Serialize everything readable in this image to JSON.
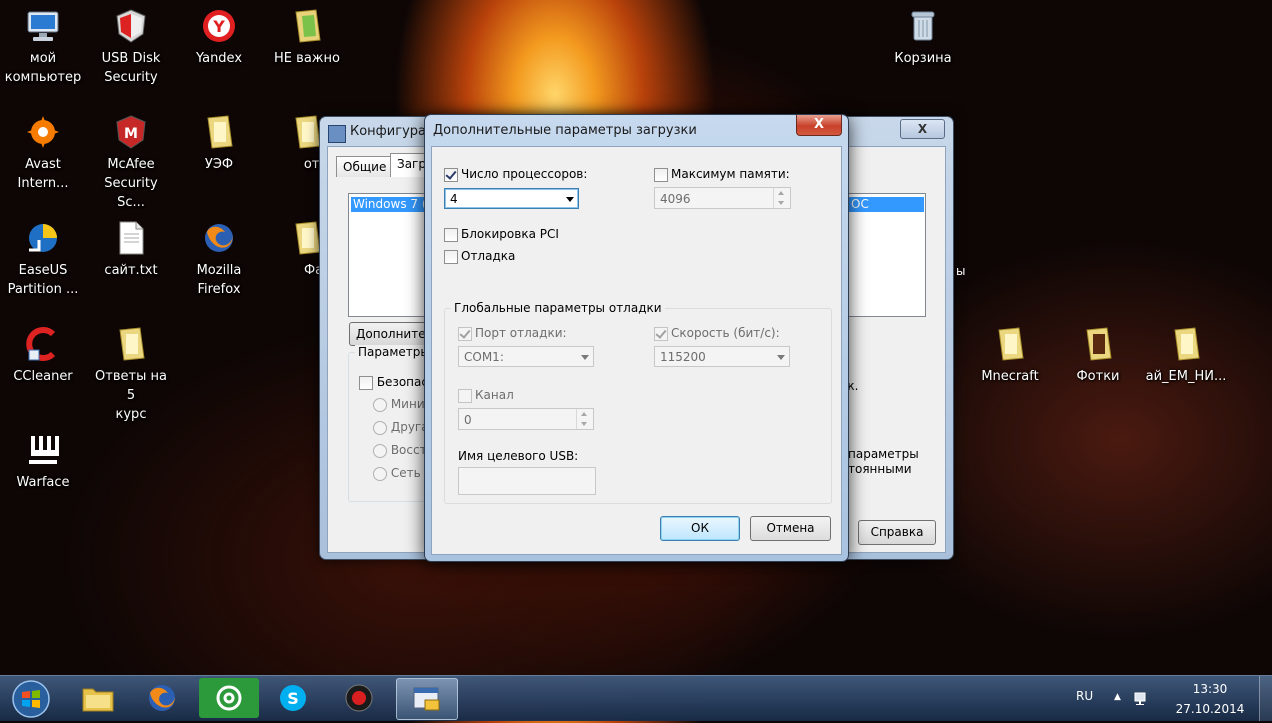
{
  "desktop": {
    "icons": [
      {
        "label": "мой\nкомпьютер",
        "icon": "computer-icon"
      },
      {
        "label": "USB Disk\nSecurity",
        "icon": "usb-disk-security-icon"
      },
      {
        "label": "Yandex",
        "icon": "yandex-icon"
      },
      {
        "label": "НЕ важно",
        "icon": "folder-icon"
      },
      {
        "label": "Корзина",
        "icon": "recycle-bin-icon"
      },
      {
        "label": "Avast\nIntern...",
        "icon": "avast-icon"
      },
      {
        "label": "McAfee\nSecurity Sc...",
        "icon": "mcafee-icon"
      },
      {
        "label": "УЭФ",
        "icon": "folder-icon"
      },
      {
        "label": "отве",
        "icon": "folder-icon"
      },
      {
        "label": "EaseUS\nPartition ...",
        "icon": "easeus-icon"
      },
      {
        "label": "сайт.txt",
        "icon": "text-file-icon"
      },
      {
        "label": "Mozilla\nFirefox",
        "icon": "firefox-icon"
      },
      {
        "label": "Фарі",
        "icon": "folder-icon"
      },
      {
        "label": "CCleaner",
        "icon": "ccleaner-icon"
      },
      {
        "label": "Ответы на 5\nкурс",
        "icon": "folder-icon"
      },
      {
        "label": "Warface",
        "icon": "warface-icon"
      },
      {
        "label": "Mnecraft",
        "icon": "folder-icon"
      },
      {
        "label": "Фотки",
        "icon": "folder-icon"
      },
      {
        "label": "ай_ЕМ_НИ...",
        "icon": "folder-icon"
      }
    ]
  },
  "back_window": {
    "title": "Конфигурац",
    "tabs": [
      "Общие",
      "Загруз"
    ],
    "list_item": "Windows 7 (C",
    "list_item_right": "OC",
    "advanced_button": "Дополнител",
    "group_label": "Параметры з",
    "safe_mode_label": "Безопас",
    "radio_labels": [
      "Миним",
      "Другая",
      "Восста",
      "Сеть"
    ],
    "side_text_1": "ек.",
    "side_text_2": "ы",
    "side_text_3a": "параметры",
    "side_text_3b": "тоянными",
    "help_button": "Справка",
    "close_glyph": "X"
  },
  "dialog": {
    "title": "Дополнительные параметры загрузки",
    "close_glyph": "X",
    "num_processors": {
      "label": "Число процессоров:",
      "checked": true,
      "value": "4"
    },
    "max_memory": {
      "label": "Максимум памяти:",
      "checked": false,
      "value": "4096"
    },
    "pci_lock": {
      "label": "Блокировка PCI",
      "checked": false
    },
    "debug": {
      "label": "Отладка",
      "checked": false
    },
    "debug_group": {
      "label": "Глобальные параметры отладки",
      "debug_port": {
        "label": "Порт отладки:",
        "checked": true,
        "value": "COM1:"
      },
      "baud_rate": {
        "label": "Скорость (бит/с):",
        "checked": true,
        "value": "115200"
      },
      "channel": {
        "label": "Канал",
        "checked": false,
        "value": "0"
      },
      "usb_target": {
        "label": "Имя целевого USB:",
        "value": ""
      }
    },
    "ok_button": "ОК",
    "cancel_button": "Отмена"
  },
  "taskbar": {
    "buttons": [
      "explorer-icon",
      "firefox-icon",
      "mail-agent-icon",
      "skype-icon",
      "record-icon",
      "msconfig-icon"
    ],
    "language": "RU",
    "time": "13:30",
    "date": "27.10.2014"
  },
  "colors": {
    "selection": "#3399ff",
    "close_red": "#c7412a",
    "taskbar": "#2d4b73"
  }
}
